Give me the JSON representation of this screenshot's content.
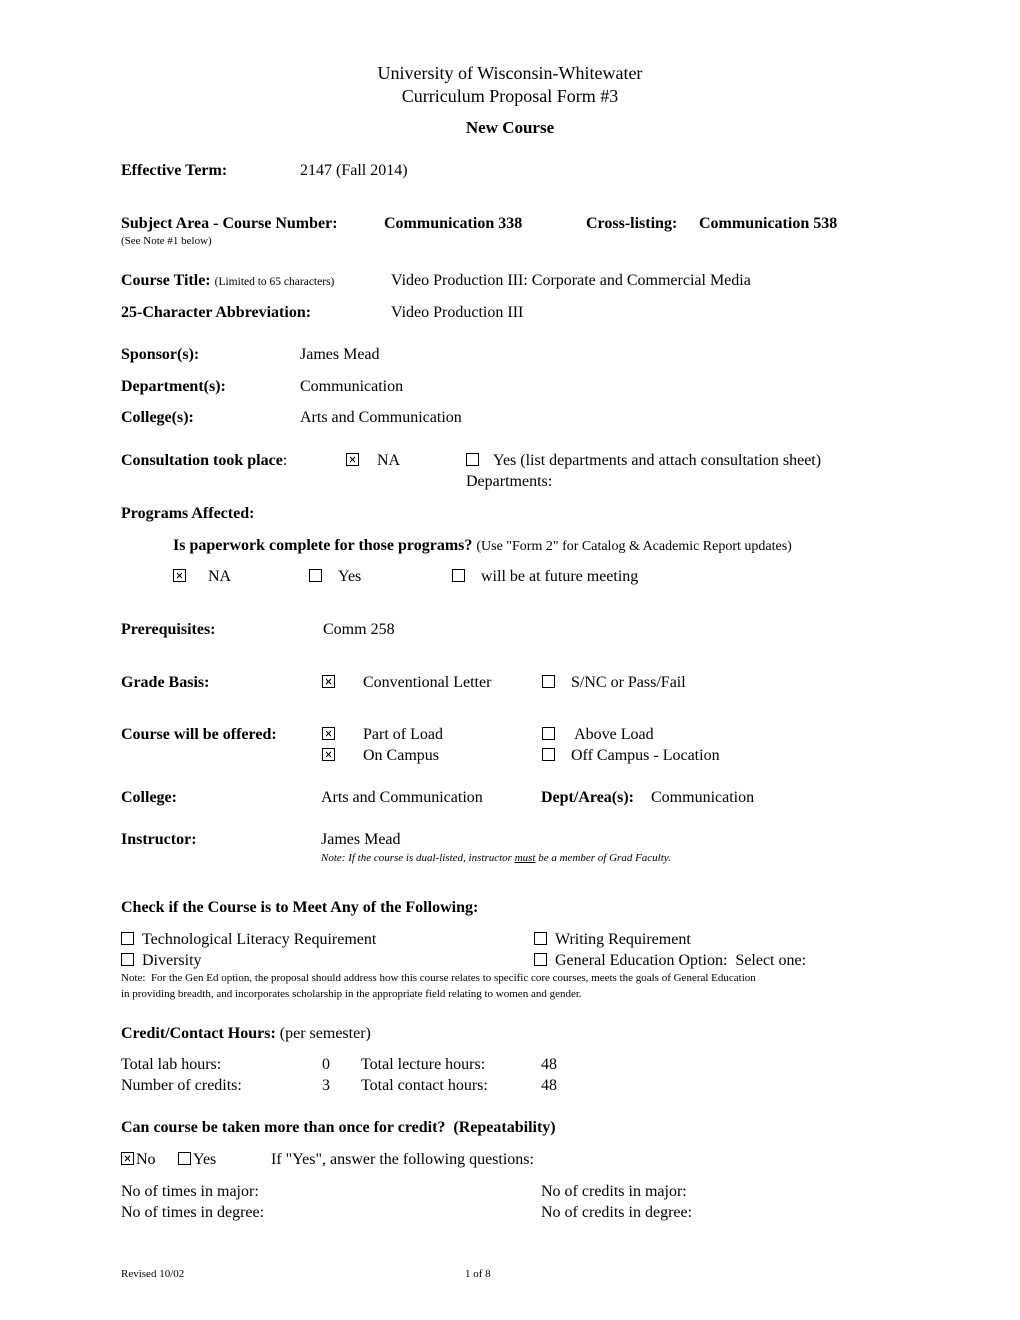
{
  "header": {
    "university": "University of Wisconsin-Whitewater",
    "form_title": "Curriculum Proposal Form #3",
    "form_type": "New Course"
  },
  "effective_term": {
    "label": "Effective Term:",
    "value": "2147 (Fall 2014)"
  },
  "subject": {
    "label": "Subject Area - Course Number:",
    "value": "Communication 338",
    "crosslist_label": "Cross-listing:",
    "crosslist_value": "Communication 538",
    "note": "(See Note #1 below)"
  },
  "course_title": {
    "label": "Course Title:",
    "hint": "(Limited to 65 characters)",
    "value": "Video Production III: Corporate and Commercial Media"
  },
  "abbreviation": {
    "label": "25-Character Abbreviation:",
    "value": "Video Production III"
  },
  "sponsors": {
    "label": "Sponsor(s):",
    "value": "James Mead"
  },
  "departments": {
    "label": "Department(s):",
    "value": "Communication"
  },
  "colleges": {
    "label": "College(s):",
    "value": "Arts and Communication"
  },
  "consultation": {
    "label": "Consultation took place",
    "colon": ":",
    "options": [
      {
        "label": "NA",
        "checked": true
      },
      {
        "label": "Yes  (list departments and attach consultation sheet)",
        "checked": false
      }
    ],
    "departments_label": "Departments:"
  },
  "programs_affected": {
    "label": "Programs Affected:",
    "question": "Is paperwork complete for those programs?",
    "question_hint": "(Use \"Form 2\" for Catalog & Academic Report updates)",
    "options": [
      {
        "label": "NA",
        "checked": true
      },
      {
        "label": "Yes",
        "checked": false
      },
      {
        "label": "will be at future meeting",
        "checked": false
      }
    ]
  },
  "prerequisites": {
    "label": "Prerequisites:",
    "value": "Comm 258"
  },
  "grade_basis": {
    "label": "Grade Basis:",
    "options": [
      {
        "label": "Conventional Letter",
        "checked": true
      },
      {
        "label": "S/NC or Pass/Fail",
        "checked": false
      }
    ]
  },
  "offered": {
    "label": "Course will be offered:",
    "options": [
      {
        "label": "Part of Load",
        "checked": true
      },
      {
        "label": " Above Load",
        "checked": false
      },
      {
        "label": "On Campus",
        "checked": true
      },
      {
        "label": "Off Campus - Location",
        "checked": false
      }
    ]
  },
  "college": {
    "label": "College:",
    "value": "Arts and Communication",
    "dept_label": "Dept/Area(s):",
    "dept_value": "Communication"
  },
  "instructor": {
    "label": "Instructor:",
    "value": "James Mead",
    "note_before": "Note: If the course is dual-listed, instructor ",
    "note_emphasis": "must",
    "note_after": " be a member of Grad Faculty."
  },
  "requirements": {
    "heading": "Check if the Course is to Meet Any of the Following:",
    "options": [
      {
        "label": "Technological Literacy Requirement",
        "checked": false
      },
      {
        "label": "Writing Requirement",
        "checked": false
      },
      {
        "label": "Diversity",
        "checked": false
      },
      {
        "label": "General Education Option:  Select one:",
        "checked": false
      }
    ],
    "note_line1": "Note:  For the Gen Ed option, the proposal should address how this course relates to specific core courses, meets the goals of General Education",
    "note_line2": "in providing breadth, and incorporates scholarship in the appropriate field relating to women and gender."
  },
  "hours": {
    "heading": "Credit/Contact Hours:",
    "heading_hint": "(per semester)",
    "lab_label": "Total lab hours:",
    "lab_value": "0",
    "lecture_label": "Total lecture hours:",
    "lecture_value": "48",
    "credits_label": "Number of credits:",
    "credits_value": "3",
    "contact_label": "Total contact hours:",
    "contact_value": "48"
  },
  "repeatability": {
    "heading": "Can course be taken more than once for credit?  (Repeatability)",
    "options": [
      {
        "label": "No",
        "checked": true
      },
      {
        "label": "Yes",
        "checked": false
      }
    ],
    "instruction": "If \"Yes\", answer the following questions:",
    "times_major": "No of times in major:",
    "credits_major": "No of credits in major:",
    "times_degree": "No of times in degree:",
    "credits_degree": "No of credits in degree:"
  },
  "footer": {
    "revised": "Revised 10/02",
    "page": "1 of 8"
  }
}
